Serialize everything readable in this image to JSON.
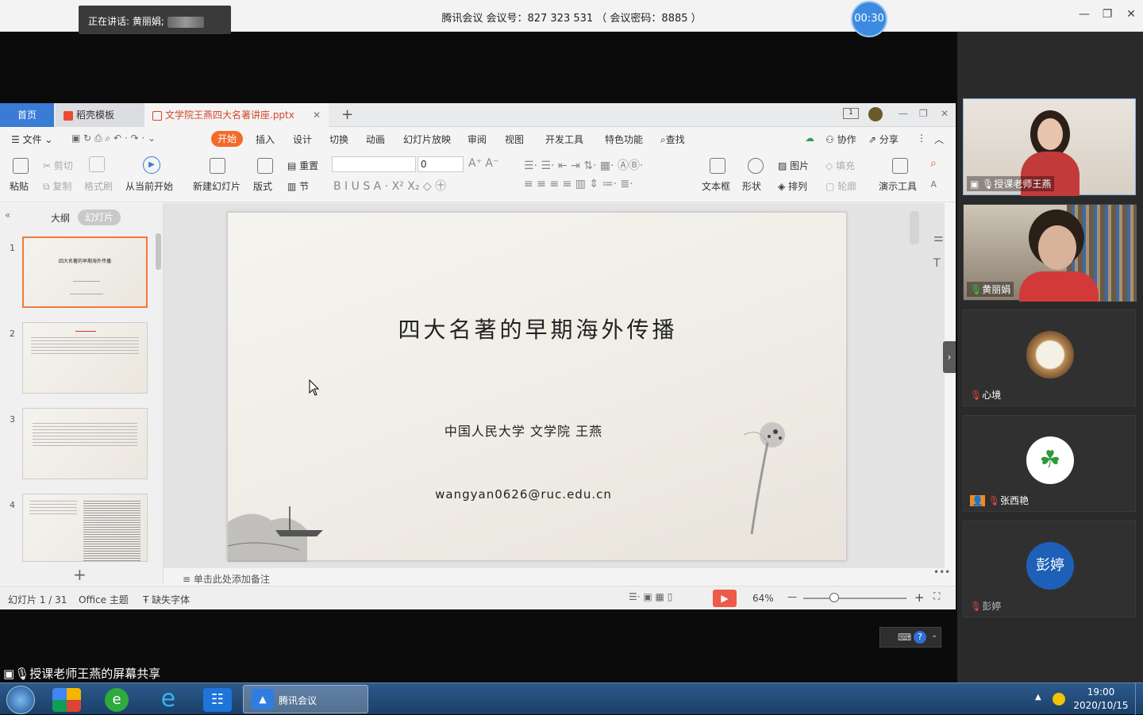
{
  "meeting": {
    "speaking_label": "正在讲话: 黄丽娟;",
    "title": "腾讯会议 会议号：827 323 531 （ 会议密码：8885 ）",
    "timer": "00:30"
  },
  "wps": {
    "tabs": {
      "home": "首页",
      "template": "稻壳模板",
      "document": "文学院王燕四大名著讲座.pptx"
    },
    "menu": {
      "file": "文件",
      "start": "开始",
      "insert": "插入",
      "design": "设计",
      "transition": "切换",
      "animation": "动画",
      "slideshow": "幻灯片放映",
      "review": "审阅",
      "view": "视图",
      "dev": "开发工具",
      "special": "特色功能",
      "search": "查找",
      "collab": "协作",
      "share": "分享"
    },
    "ribbon": {
      "paste": "粘贴",
      "cut": "剪切",
      "copy": "复制",
      "format_painter": "格式刷",
      "from_current": "从当前开始",
      "new_slide": "新建幻灯片",
      "layout": "版式",
      "reset": "重置",
      "section": "节",
      "font_size": "0",
      "textbox": "文本框",
      "shape": "形状",
      "picture": "图片",
      "fill": "填充",
      "arrange": "排列",
      "outline": "轮廓",
      "present_tools": "演示工具"
    },
    "pane": {
      "outline": "大纲",
      "slides": "幻灯片",
      "thumbs": [
        "1",
        "2",
        "3",
        "4"
      ],
      "thumb1_title": "四大名著的早期海外传播"
    },
    "slide": {
      "title": "四大名著的早期海外传播",
      "author": "中国人民大学 文学院   王燕",
      "email": "wangyan0626@ruc.edu.cn"
    },
    "notes_placeholder": "单击此处添加备注",
    "status": {
      "slide_count": "幻灯片 1 / 31",
      "theme": "Office 主题",
      "missing_font": "缺失字体",
      "zoom": "64%"
    }
  },
  "participants": [
    {
      "name": "授课老师王燕"
    },
    {
      "name": "黄丽娟"
    },
    {
      "name": "心境"
    },
    {
      "name": "张西艳"
    },
    {
      "name": "彭婷",
      "avatar_text": "彭婷"
    }
  ],
  "share_label": "授课老师王燕的屏幕共享",
  "taskbar": {
    "meeting_app": "腾讯会议",
    "time": "19:00",
    "date": "2020/10/15"
  }
}
